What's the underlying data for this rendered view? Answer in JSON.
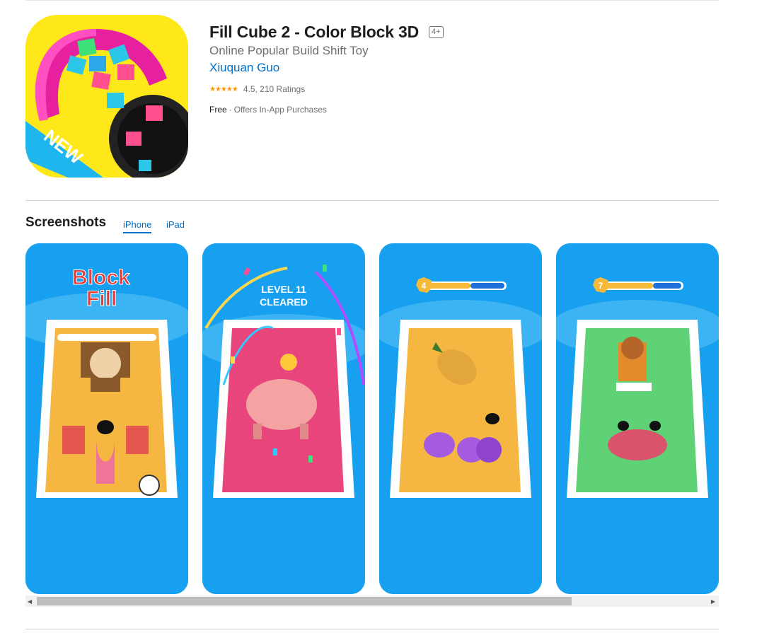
{
  "app": {
    "title": "Fill Cube 2 - Color Block 3D",
    "age_rating": "4+",
    "subtitle": "Online Popular Build Shift Toy",
    "developer": "Xiuquan Guo",
    "rating_stars": "★★★★★",
    "rating_value": 4.5,
    "rating_text": "4.5, 210 Ratings",
    "price": "Free",
    "price_separator": "·",
    "in_app": "Offers In-App Purchases",
    "icon_badge": "NEW"
  },
  "screenshots_section": {
    "heading": "Screenshots",
    "tabs": [
      "iPhone",
      "iPad"
    ],
    "selected_tab": "iPhone"
  },
  "screenshots": [
    {
      "logo_line1": "Block",
      "logo_line2": "Fill",
      "board_color": "#f5b642"
    },
    {
      "banner_line1": "LEVEL 11",
      "banner_line2": "CLEARED",
      "board_color": "#e8457d"
    },
    {
      "level": "4",
      "board_color": "#f5b642",
      "progress": 0.55
    },
    {
      "level": "7",
      "board_color": "#5fd277",
      "progress": 0.6
    }
  ],
  "scrollbar": {
    "left_arrow": "◀",
    "right_arrow": "▶"
  },
  "colors": {
    "accent": "#0070c9",
    "star": "#ff9500",
    "screen_bg": "#18a0f0"
  }
}
